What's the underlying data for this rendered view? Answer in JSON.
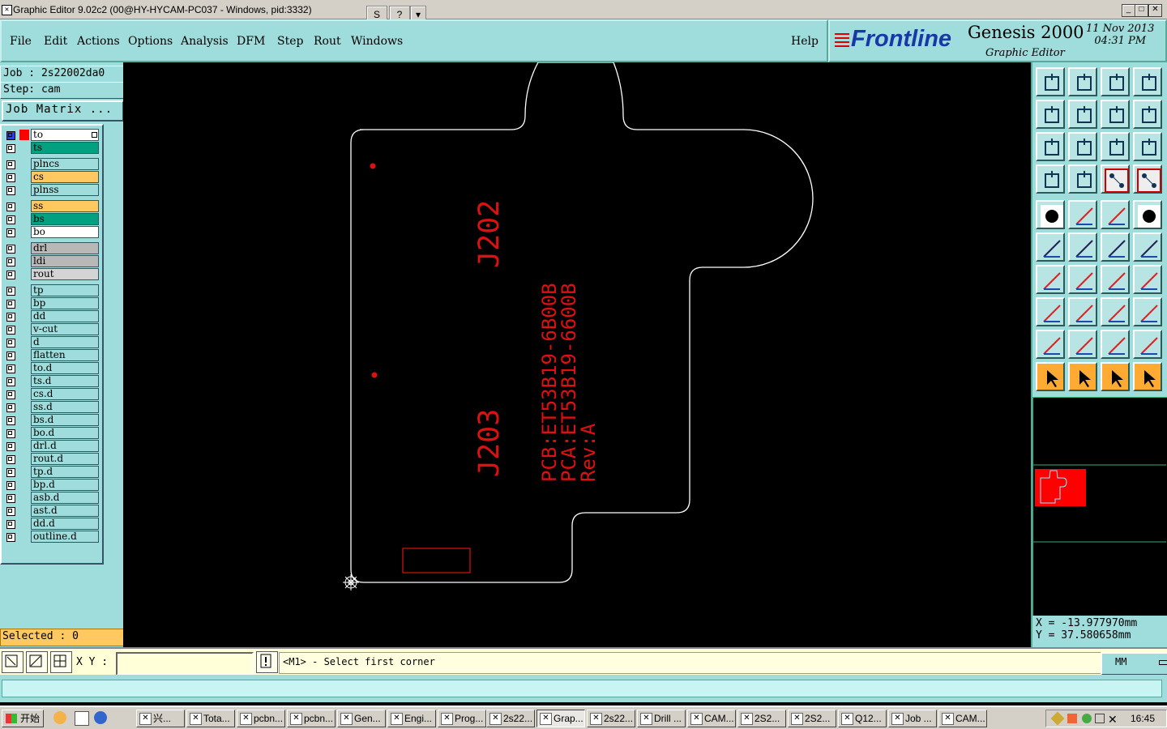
{
  "window": {
    "title": "Graphic Editor 9.02c2 (00@HY-HYCAM-PC037 - Windows, pid:3332)",
    "controls": [
      "_",
      "□",
      "✕"
    ],
    "toolbar_icons": [
      "S",
      "?",
      "▾"
    ]
  },
  "menu": {
    "items": [
      "File",
      "Edit",
      "Actions",
      "Options",
      "Analysis",
      "DFM",
      "Step",
      "Rout",
      "Windows"
    ],
    "help": "Help"
  },
  "brand": {
    "logo": "Frontline",
    "product": "Genesis 2000",
    "subtitle": "Graphic Editor",
    "date": "11 Nov 2013",
    "time": "04:31 PM"
  },
  "job": {
    "job_line": "Job : 2s22002da0",
    "step_line": "Step: cam",
    "matrix_button": "Job Matrix ..."
  },
  "layers": [
    {
      "name": "to",
      "color": "#ffffff",
      "dot": "#ff0000",
      "sel": true
    },
    {
      "name": "ts",
      "color": "#00a080"
    },
    {
      "name": "plncs",
      "color": "#9fdcdc"
    },
    {
      "name": "cs",
      "color": "#ffc860"
    },
    {
      "name": "plnss",
      "color": "#9fdcdc"
    },
    {
      "name": "ss",
      "color": "#ffc860"
    },
    {
      "name": "bs",
      "color": "#00a080"
    },
    {
      "name": "bo",
      "color": "#ffffff"
    },
    {
      "name": "drl",
      "color": "#b8b8b8"
    },
    {
      "name": "ldi",
      "color": "#b8b8b8"
    },
    {
      "name": "rout",
      "color": "#d4d4d4"
    },
    {
      "name": "tp",
      "color": "#9fdcdc"
    },
    {
      "name": "bp",
      "color": "#9fdcdc"
    },
    {
      "name": "dd",
      "color": "#9fdcdc"
    },
    {
      "name": "v-cut",
      "color": "#9fdcdc"
    },
    {
      "name": "d",
      "color": "#9fdcdc"
    },
    {
      "name": "flatten",
      "color": "#9fdcdc"
    },
    {
      "name": "to.d",
      "color": "#9fdcdc"
    },
    {
      "name": "ts.d",
      "color": "#9fdcdc"
    },
    {
      "name": "cs.d",
      "color": "#9fdcdc"
    },
    {
      "name": "ss.d",
      "color": "#9fdcdc"
    },
    {
      "name": "bs.d",
      "color": "#9fdcdc"
    },
    {
      "name": "bo.d",
      "color": "#9fdcdc"
    },
    {
      "name": "drl.d",
      "color": "#9fdcdc"
    },
    {
      "name": "rout.d",
      "color": "#9fdcdc"
    },
    {
      "name": "tp.d",
      "color": "#9fdcdc"
    },
    {
      "name": "bp.d",
      "color": "#9fdcdc"
    },
    {
      "name": "asb.d",
      "color": "#9fdcdc"
    },
    {
      "name": "ast.d",
      "color": "#9fdcdc"
    },
    {
      "name": "dd.d",
      "color": "#9fdcdc"
    },
    {
      "name": "outline.d",
      "color": "#9fdcdc"
    }
  ],
  "selected": "Selected : 0",
  "canvas": {
    "labels": {
      "j202": "J202",
      "j203": "J203",
      "pcb": "PCB:ET53B19-6B00B",
      "pca": "PCA:ET53B19-6600B",
      "rev": "Rev:A"
    },
    "outline_color": "#ffffff",
    "text_color": "#dd1111"
  },
  "coordinates": {
    "x": "X = -13.977970mm",
    "y": "Y = 37.580658mm"
  },
  "bottom": {
    "xy_label": "X Y :",
    "xy_value": "",
    "message": "<M1> - Select first corner",
    "units": "MM"
  },
  "taskbar": {
    "start": "开始",
    "tasks": [
      "兴...",
      "Tota...",
      "pcbn...",
      "pcbn...",
      "Gen...",
      "Engi...",
      "Prog...",
      "2s22...",
      "Grap...",
      "2s22...",
      "Drill ...",
      "CAM...",
      "2S2...",
      "2S2...",
      "Q12...",
      "Job ...",
      "CAM..."
    ],
    "clock": "16:45"
  }
}
